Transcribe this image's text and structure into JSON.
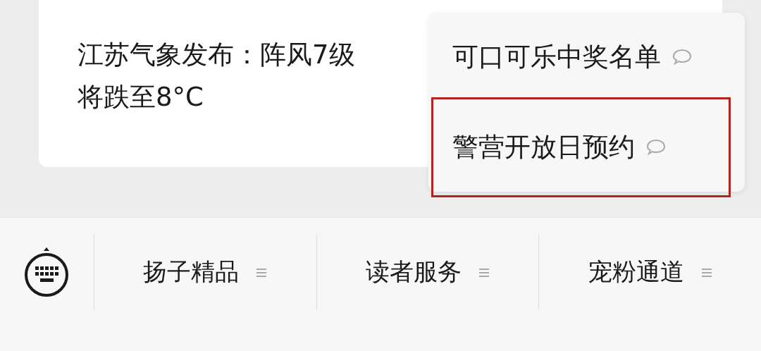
{
  "message": {
    "text": "江苏气象发布：阵风7级将跌至8°C"
  },
  "popup_menu": {
    "items": [
      {
        "label": "可口可乐中奖名单",
        "highlighted": false
      },
      {
        "label": "警营开放日预约",
        "highlighted": true
      }
    ]
  },
  "bottom_menu": {
    "items": [
      {
        "label": "扬子精品"
      },
      {
        "label": "读者服务"
      },
      {
        "label": "宠粉通道"
      }
    ]
  }
}
